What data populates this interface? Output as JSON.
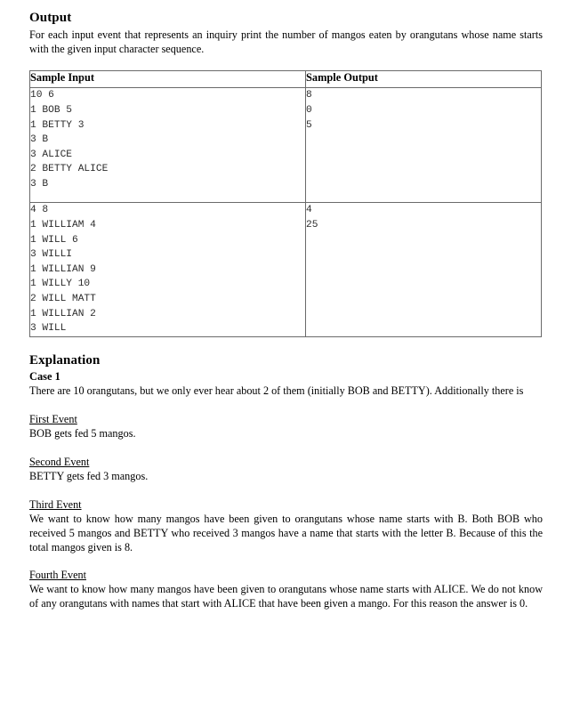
{
  "output_section": {
    "heading": "Output",
    "description": "For each input event that represents an inquiry print the number of mangos eaten by orangutans whose name starts with the given input character sequence."
  },
  "sample_table": {
    "headers": [
      "Sample Input",
      "Sample Output"
    ],
    "rows": [
      {
        "input": "10 6\n1 BOB 5\n1 BETTY 3\n3 B\n3 ALICE\n2 BETTY ALICE\n3 B",
        "output": "8\n0\n5"
      },
      {
        "input": "4 8\n1 WILLIAM 4\n1 WILL 6\n3 WILLI\n1 WILLIAN 9\n1 WILLY 10\n2 WILL MATT\n1 WILLIAN 2\n3 WILL",
        "output": "4\n25"
      }
    ]
  },
  "explanation_section": {
    "heading": "Explanation",
    "case_title": "Case 1",
    "case_intro": "There are 10 orangutans, but we only ever hear about 2 of them (initially BOB and BETTY). Additionally there is",
    "events": [
      {
        "title": "First Event",
        "body": "BOB gets fed 5 mangos."
      },
      {
        "title": "Second Event",
        "body": "BETTY gets fed 3 mangos."
      },
      {
        "title": "Third Event",
        "body": "We want to know how many mangos have been given to orangutans whose name starts with B.  Both BOB who received 5 mangos and BETTY who received 3 mangos have a name that starts with the letter B.  Because of this the total mangos given is 8."
      },
      {
        "title": "Fourth Event",
        "body": "We want to know how many mangos have been given to orangutans whose name starts with ALICE.  We do not know of any orangutans with names that start with ALICE that have been given a mango.  For this reason the answer is 0."
      }
    ]
  }
}
